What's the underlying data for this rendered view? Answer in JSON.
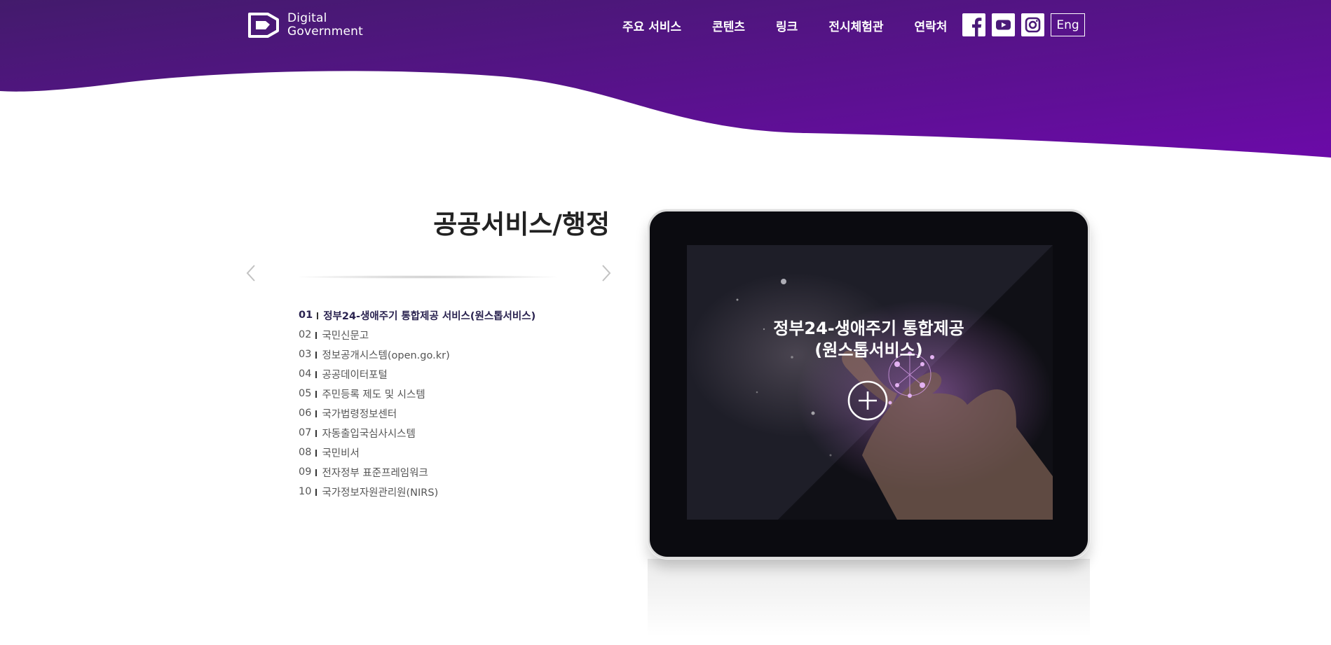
{
  "header": {
    "logo": {
      "line1": "Digital",
      "line2": "Government",
      "icon": "digital-government-logo-icon"
    },
    "nav": [
      {
        "label": "주요 서비스"
      },
      {
        "label": "콘텐츠"
      },
      {
        "label": "링크"
      },
      {
        "label": "전시체험관"
      },
      {
        "label": "연락처"
      }
    ],
    "social": [
      {
        "icon": "facebook-icon"
      },
      {
        "icon": "youtube-icon"
      },
      {
        "icon": "instagram-icon"
      }
    ],
    "lang_label": "Eng"
  },
  "section": {
    "title": "공공서비스/행정",
    "prev_icon": "chevron-left-icon",
    "next_icon": "chevron-right-icon",
    "items": [
      {
        "num": "01",
        "label": "정부24-생애주기 통합제공 서비스(원스톱서비스)",
        "active": true
      },
      {
        "num": "02",
        "label": "국민신문고"
      },
      {
        "num": "03",
        "label": "정보공개시스템(open.go.kr)"
      },
      {
        "num": "04",
        "label": "공공데이터포털"
      },
      {
        "num": "05",
        "label": "주민등록 제도 및 시스템"
      },
      {
        "num": "06",
        "label": "국가법령정보센터"
      },
      {
        "num": "07",
        "label": "자동출입국심사시스템"
      },
      {
        "num": "08",
        "label": "국민비서"
      },
      {
        "num": "09",
        "label": "전자정부 표준프레임워크"
      },
      {
        "num": "10",
        "label": "국가정보자원관리원(NIRS)"
      }
    ]
  },
  "featured": {
    "title_line1": "정부24-생애주기 통합제공",
    "title_line2": "(원스톱서비스)",
    "plus_icon": "plus-circle-icon"
  },
  "colors": {
    "header_top": "#431b6c",
    "header_bottom": "#6b0aa8",
    "title": "#222222",
    "active_item": "#2a2350"
  }
}
